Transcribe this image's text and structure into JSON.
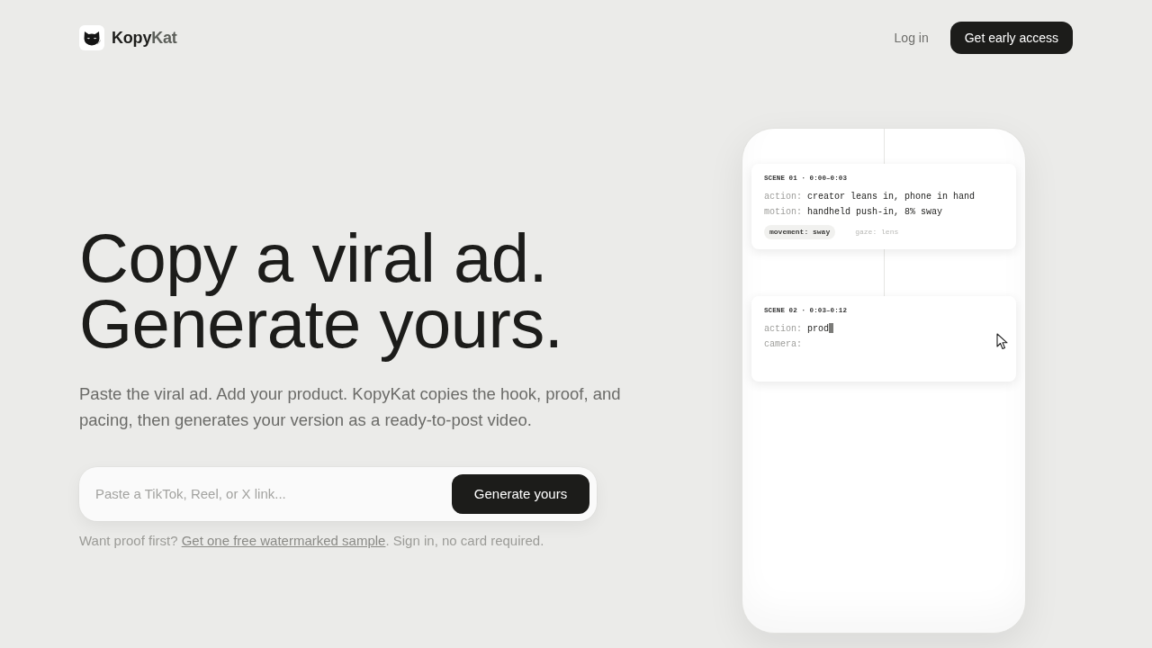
{
  "header": {
    "brand": {
      "part_1": "Kopy",
      "part_2": "Kat"
    },
    "actions": [
      {
        "kind": "link",
        "label": "Log in"
      },
      {
        "kind": "button",
        "label": "Get early access"
      }
    ]
  },
  "hero": {
    "title_lines": [
      "Copy a viral ad.",
      "Generate yours."
    ],
    "description": "Paste the viral ad. Add your product. KopyKat copies the hook, proof, and pacing, then generates your version as a ready-to-post video.",
    "link_form": {
      "placeholder": "Paste a TikTok, Reel, or X link...",
      "button": "Generate yours"
    },
    "note": {
      "before": "Want proof first? ",
      "link": "Get one free watermarked sample",
      "after": ". Sign in, no card required."
    }
  },
  "phone": {
    "scenes": [
      {
        "heading": "SCENE 01 · 0:00–0:03",
        "fields": [
          {
            "label": "action:",
            "value": "creator leans in, phone in hand"
          },
          {
            "label": "motion:",
            "value": "handheld push-in, 8% sway"
          }
        ],
        "tags": [
          {
            "label": "movement: sway",
            "faded": false
          },
          {
            "label": "gaze: lens",
            "faded": true
          }
        ]
      },
      {
        "heading": "SCENE 02 · 0:03–0:12",
        "fields": [
          {
            "label": "action:",
            "value": "prod",
            "typing": true
          },
          {
            "label": "camera:"
          }
        ]
      }
    ]
  }
}
